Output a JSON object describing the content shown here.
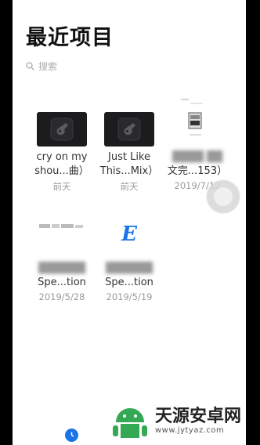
{
  "header": {
    "title": "最近项目"
  },
  "search": {
    "placeholder": "搜索",
    "icon": "search-icon"
  },
  "items": [
    {
      "name_line1": "cry on my",
      "name_line2": "shou...曲）",
      "meta": "前天",
      "kind": "music"
    },
    {
      "name_line1": "Just Like",
      "name_line2": "This...Mix）",
      "meta": "前天",
      "kind": "music"
    },
    {
      "name_line1": "",
      "name_line2": "文完...153）",
      "meta": "2019/7/12",
      "kind": "document"
    },
    {
      "name_line1": "",
      "name_line2": "Spe...tion",
      "meta": "2019/5/28",
      "kind": "document"
    },
    {
      "name_line1": "",
      "name_line2": "Spe...tion",
      "meta": "2019/5/19",
      "kind": "epub",
      "letter": "E"
    }
  ],
  "watermark": {
    "line1": "天源安卓网",
    "line2": "www.jytyaz.com"
  },
  "colors": {
    "accent": "#1a73e8",
    "thumb_dark": "#1c1c1e"
  }
}
